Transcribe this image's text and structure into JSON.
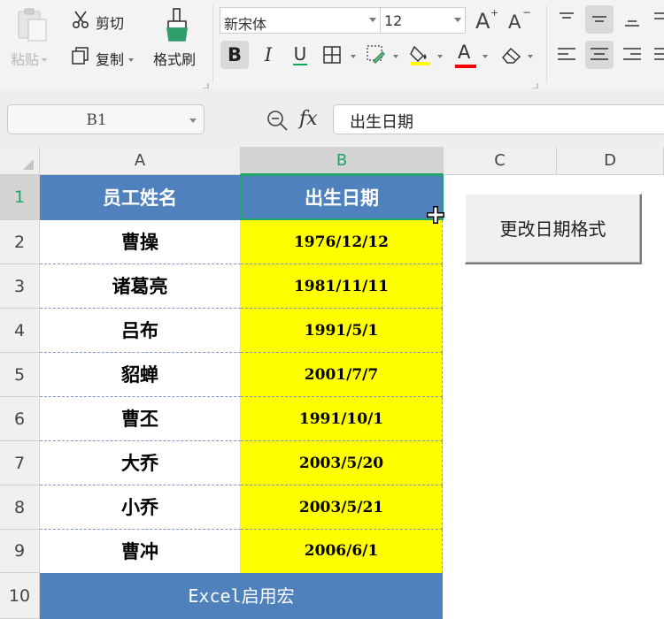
{
  "ribbon": {
    "paste_label": "粘贴",
    "cut_label": "剪切",
    "copy_label": "复制",
    "format_painter_label": "格式刷",
    "font_name": "新宋体",
    "font_size": "12",
    "bold_glyph": "B",
    "italic_glyph": "I",
    "underline_glyph": "U",
    "font_color_glyph": "A",
    "colors": {
      "underline_accent": "#00b050",
      "font_color": "#ff0000",
      "highlight": "#ffff00"
    }
  },
  "formula_bar": {
    "name_box": "B1",
    "fx_label": "fx",
    "formula_value": "出生日期"
  },
  "columns": [
    "A",
    "B",
    "C",
    "D"
  ],
  "rows": [
    "1",
    "2",
    "3",
    "4",
    "5",
    "6",
    "7",
    "8",
    "9",
    "10"
  ],
  "table": {
    "headers": [
      "员工姓名",
      "出生日期"
    ],
    "rows": [
      [
        "曹操",
        "1976/12/12"
      ],
      [
        "诸葛亮",
        "1981/11/11"
      ],
      [
        "吕布",
        "1991/5/1"
      ],
      [
        "貂蝉",
        "2001/7/7"
      ],
      [
        "曹丕",
        "1991/10/1"
      ],
      [
        "大乔",
        "2003/5/20"
      ],
      [
        "小乔",
        "2003/5/21"
      ],
      [
        "曹冲",
        "2006/6/1"
      ]
    ],
    "footer": "Excel启用宏"
  },
  "macro_button_label": "更改日期格式",
  "theme": {
    "header_blue": "#4f81bd",
    "date_fill": "#ffff00",
    "select_green": "#21a366"
  }
}
